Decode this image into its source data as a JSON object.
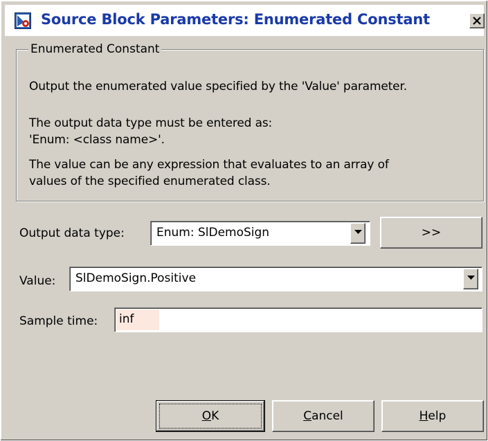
{
  "window": {
    "title": "Source Block Parameters: Enumerated Constant"
  },
  "group": {
    "legend": "Enumerated Constant",
    "description_lines": [
      "Output the enumerated value specified by the 'Value' parameter.",
      "The output data type must be entered as:",
      " 'Enum: <class name>'.",
      "The value can be any expression that evaluates to an array of",
      "values of the specified enumerated class."
    ]
  },
  "params": {
    "output_data_type": {
      "label": "Output data type:",
      "value": "Enum: SlDemoSign",
      "assistant_label": ">>"
    },
    "value": {
      "label": "Value:",
      "value": "SlDemoSign.Positive"
    },
    "sample_time": {
      "label": "Sample time:",
      "value": "inf"
    }
  },
  "buttons": {
    "ok": {
      "mnemonic": "O",
      "rest": "K"
    },
    "cancel": {
      "mnemonic": "C",
      "rest": "ancel"
    },
    "help": {
      "mnemonic": "H",
      "rest": "elp"
    }
  }
}
